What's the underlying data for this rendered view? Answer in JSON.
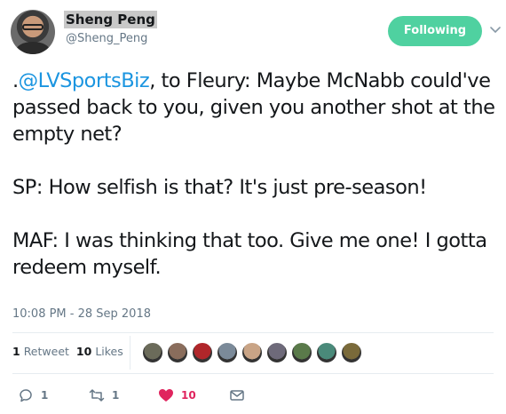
{
  "user": {
    "name": "Sheng Peng",
    "handle": "@Sheng_Peng",
    "avatar_icon": "user-avatar"
  },
  "follow_button": {
    "label": "Following",
    "color": "#4fd1a0"
  },
  "menu_icon": "chevron-down-icon",
  "tweet": {
    "mention": "@LVSportsBiz",
    "para1_prefix": ".",
    "para1_rest": ", to Fleury: Maybe McNabb could've passed back to you, given you another shot at the empty net?",
    "para2": "SP: How selfish is that? It's just pre-season!",
    "para3": "MAF: I was thinking that too. Give me one! I gotta redeem myself.",
    "mention_color": "#1b95e0"
  },
  "timestamp": "10:08 PM - 28 Sep 2018",
  "stats": {
    "retweets_count": "1",
    "retweets_label": "Retweet",
    "likes_count": "10",
    "likes_label": "Likes"
  },
  "likers": [
    {
      "icon": "liker-avatar-1",
      "color": "#6b6b5a"
    },
    {
      "icon": "liker-avatar-2",
      "color": "#8a6d5c"
    },
    {
      "icon": "liker-avatar-3",
      "color": "#b0262a"
    },
    {
      "icon": "liker-avatar-4",
      "color": "#7b8a99"
    },
    {
      "icon": "liker-avatar-5",
      "color": "#c9a486"
    },
    {
      "icon": "liker-avatar-6",
      "color": "#6e6a7a"
    },
    {
      "icon": "liker-avatar-7",
      "color": "#5a7a4a"
    },
    {
      "icon": "liker-avatar-8",
      "color": "#4a8a7a"
    },
    {
      "icon": "liker-avatar-9",
      "color": "#7a6a3a"
    }
  ],
  "actions": {
    "reply_count": "1",
    "retweet_count": "1",
    "like_count": "10",
    "like_color": "#e0245e"
  }
}
